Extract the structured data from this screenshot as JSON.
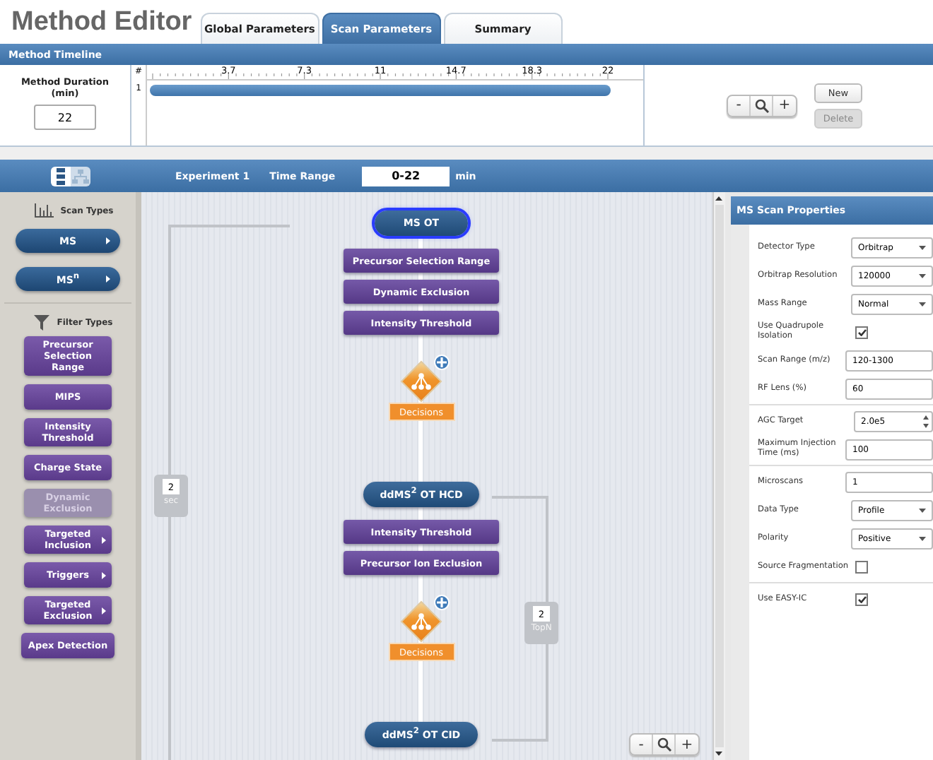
{
  "app_title": "Method Editor",
  "tabs": [
    {
      "label": "Global Parameters",
      "selected": false
    },
    {
      "label": "Scan Parameters",
      "selected": true
    },
    {
      "label": "Summary",
      "selected": false
    }
  ],
  "timeline": {
    "title": "Method Timeline",
    "duration_label": "Method Duration (min)",
    "duration": "22",
    "row_header": "#",
    "rows": [
      "1"
    ],
    "ticks": [
      "3.7",
      "7.3",
      "11",
      "14.7",
      "18.3",
      "22"
    ],
    "zoom": {
      "minus": "-",
      "plus": "+"
    },
    "buttons": [
      {
        "label": "New",
        "disabled": false
      },
      {
        "label": "Delete",
        "disabled": true
      }
    ]
  },
  "experiment_bar": {
    "view_toggle": [
      {
        "kind": "list",
        "selected": true
      },
      {
        "kind": "tree",
        "selected": false
      }
    ],
    "experiment": "Experiment 1",
    "time_range_label": "Time Range",
    "time_range": "0-22",
    "unit": "min"
  },
  "palette": {
    "scan_types_label": "Scan Types",
    "scan_types": [
      {
        "label": "MS",
        "has_menu": true
      },
      {
        "label": "MS$^{n}$",
        "has_menu": true
      }
    ],
    "filter_types_label": "Filter Types",
    "filter_types": [
      {
        "label": "Precursor Selection Range",
        "disabled": false,
        "has_menu": false
      },
      {
        "label": "MIPS",
        "disabled": false,
        "has_menu": false
      },
      {
        "label": "Intensity Threshold",
        "disabled": false,
        "has_menu": false
      },
      {
        "label": "Charge State",
        "disabled": false,
        "has_menu": false
      },
      {
        "label": "Dynamic Exclusion",
        "disabled": true,
        "has_menu": false
      },
      {
        "label": "Targeted Inclusion",
        "disabled": false,
        "has_menu": true
      },
      {
        "label": "Triggers",
        "disabled": false,
        "has_menu": true
      },
      {
        "label": "Targeted Exclusion",
        "disabled": false,
        "has_menu": true
      },
      {
        "label": "Apex Detection",
        "disabled": false,
        "has_menu": false
      }
    ]
  },
  "workflow": {
    "stages": [
      {
        "scan": {
          "label": "MS OT",
          "selected": true
        },
        "filters": [
          "Precursor Selection Range",
          "Dynamic Exclusion",
          "Intensity Threshold"
        ],
        "decision": "Decisions"
      },
      {
        "scan": {
          "label": "ddMS$^{2}$ OT HCD",
          "selected": false
        },
        "filters": [
          "Intensity Threshold",
          "Precursor Ion Exclusion"
        ],
        "decision": "Decisions"
      },
      {
        "scan": {
          "label": "ddMS$^{2}$ OT CID",
          "selected": false
        }
      }
    ],
    "loops": [
      {
        "value": "2",
        "unit": "sec"
      },
      {
        "value": "2",
        "unit": "TopN"
      }
    ],
    "zoom": {
      "minus": "-",
      "plus": "+"
    }
  },
  "properties": {
    "title": "MS Scan Properties",
    "groups": [
      [
        {
          "label": "Detector Type",
          "kind": "select",
          "value": "Orbitrap"
        },
        {
          "label": "Orbitrap Resolution",
          "kind": "select",
          "value": "120000"
        },
        {
          "label": "Mass Range",
          "kind": "select",
          "value": "Normal"
        },
        {
          "label": "Use Quadrupole Isolation",
          "kind": "checkbox",
          "checked": true
        },
        {
          "label": "Scan Range (m/z)",
          "kind": "input",
          "value": "120-1300"
        },
        {
          "label": "RF Lens (%)",
          "kind": "input",
          "value": "60"
        }
      ],
      [
        {
          "label": "AGC Target",
          "kind": "spinner",
          "value": "2.0e5"
        },
        {
          "label": "Maximum Injection Time (ms)",
          "kind": "input",
          "value": "100"
        }
      ],
      [
        {
          "label": "Microscans",
          "kind": "input",
          "value": "1"
        },
        {
          "label": "Data Type",
          "kind": "select",
          "value": "Profile"
        },
        {
          "label": "Polarity",
          "kind": "select",
          "value": "Positive"
        },
        {
          "label": "Source Fragmentation",
          "kind": "checkbox",
          "checked": false
        }
      ],
      [
        {
          "label": "Use EASY-IC",
          "kind": "checkbox",
          "checked": true
        }
      ]
    ]
  }
}
